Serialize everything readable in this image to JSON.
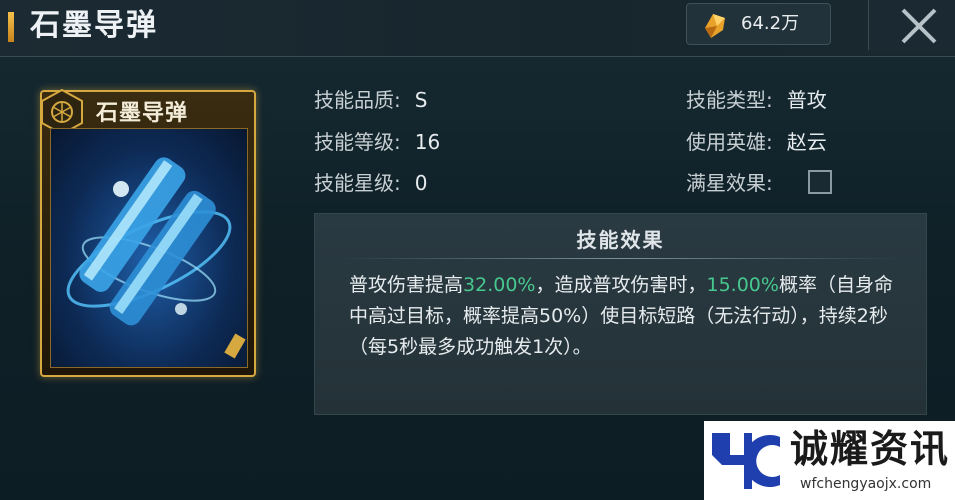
{
  "header": {
    "title": "石墨导弹",
    "currency_amount": "64.2万",
    "currency_icon": "crystal-icon",
    "close_icon": "close-icon"
  },
  "card": {
    "name": "石墨导弹",
    "emblem_icon": "hexagon-emblem-icon",
    "border_color": "#d6a840"
  },
  "stats": {
    "quality_label": "技能品质:",
    "quality_value": "S",
    "level_label": "技能等级:",
    "level_value": "16",
    "star_label": "技能星级:",
    "star_value": "0",
    "type_label": "技能类型:",
    "type_value": "普攻",
    "hero_label": "使用英雄:",
    "hero_value": "赵云",
    "max_star_label": "满星效果:"
  },
  "effect": {
    "title": "技能效果",
    "part1": "普攻伤害提高",
    "pct1": "32.00%",
    "part2": "，造成普攻伤害时，",
    "pct2": "15.00%",
    "part3": "概率（自身命中高过目标，概率提高50%）使目标短路（无法行动），持续2秒（每5秒最多成功触发1次）。",
    "highlight_color": "#47c88e"
  },
  "watermark": {
    "name": "诚耀资讯",
    "url": "wfchengyaojx.com"
  }
}
